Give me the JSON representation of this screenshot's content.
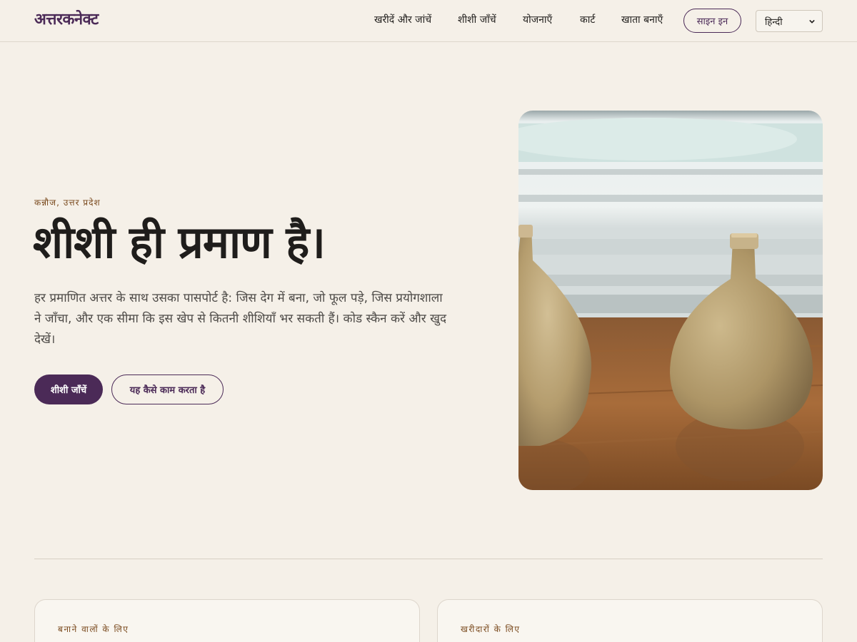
{
  "brand": {
    "name": "अत्तरकनेक्ट"
  },
  "nav": {
    "links": [
      "खरीदें और जांचें",
      "शीशी जाँचें",
      "योजनाएँ",
      "कार्ट",
      "खाता बनाएँ"
    ],
    "signin_label": "साइन इन",
    "language_selected": "हिन्दी"
  },
  "hero": {
    "eyebrow": "कन्नौज, उत्तर प्रदेश",
    "title": "शीशी ही प्रमाण है।",
    "description": "हर प्रमाणित अत्तर के साथ उसका पासपोर्ट है: जिस देग में बना, जो फूल पड़े, जिस प्रयोगशाला ने जाँचा, और एक सीमा कि इस खेप से कितनी शीशियाँ भर सकती हैं। कोड स्कैन करें और खुद देखें।",
    "primary_button": "शीशी जाँचें",
    "secondary_button": "यह कैसे काम करता है"
  },
  "cards": [
    {
      "label": "बनाने वालों के लिए"
    },
    {
      "label": "खरीदारों के लिए"
    }
  ],
  "colors": {
    "background": "#f5f0e8",
    "accent": "#4b2a57",
    "eyebrow": "#7a4a1e"
  }
}
